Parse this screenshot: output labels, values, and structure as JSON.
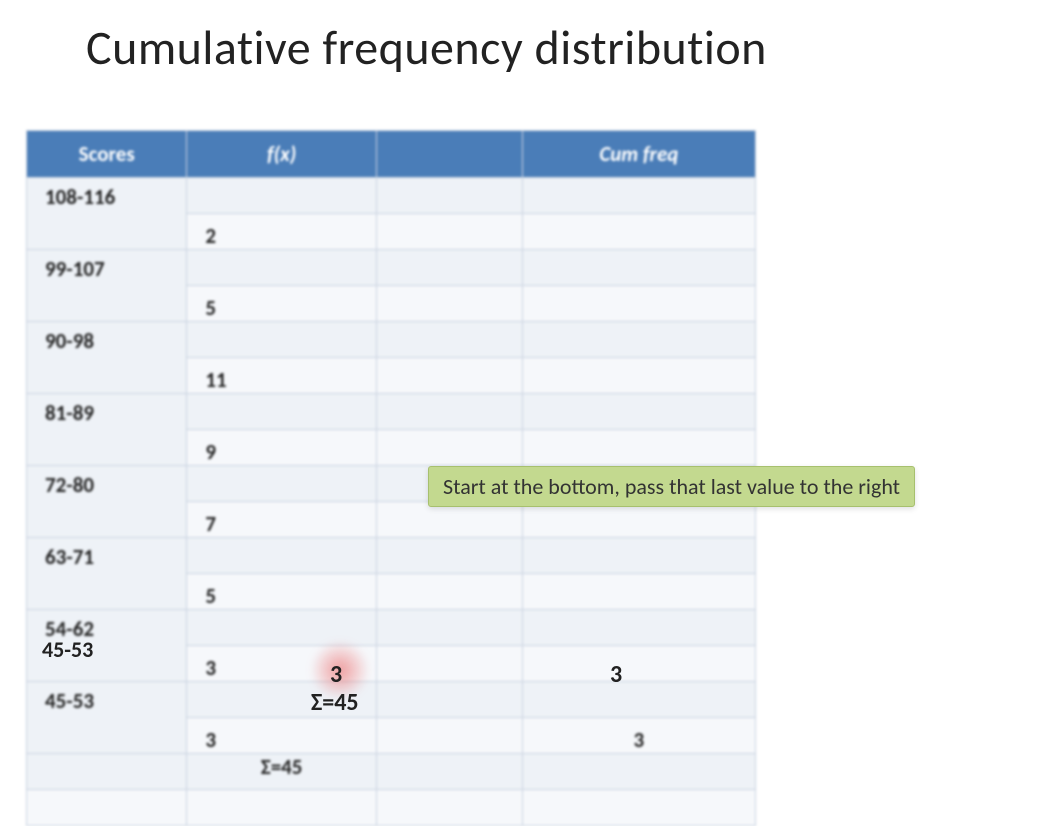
{
  "title": "Cumulative frequency distribution",
  "headers": {
    "scores": "Scores",
    "fx": "f(x)",
    "blank": "",
    "cum": "Cum freq"
  },
  "rows": [
    {
      "score": "108-116",
      "fx": "2",
      "cf": ""
    },
    {
      "score": "99-107",
      "fx": "5",
      "cf": ""
    },
    {
      "score": "90-98",
      "fx": "11",
      "cf": ""
    },
    {
      "score": "81-89",
      "fx": "9",
      "cf": ""
    },
    {
      "score": "72-80",
      "fx": "7",
      "cf": ""
    },
    {
      "score": "63-71",
      "fx": "5",
      "cf": ""
    },
    {
      "score": "54-62",
      "fx": "3",
      "cf": ""
    },
    {
      "score": "45-53",
      "fx": "3",
      "cf": "3"
    }
  ],
  "sum": "Σ=45",
  "callout": "Start at the bottom, pass that last value to the right",
  "chart_data": {
    "type": "table",
    "title": "Cumulative frequency distribution",
    "columns": [
      "Scores",
      "f(x)",
      "Cum freq"
    ],
    "data": [
      {
        "Scores": "108-116",
        "f(x)": 2,
        "Cum freq": null
      },
      {
        "Scores": "99-107",
        "f(x)": 5,
        "Cum freq": null
      },
      {
        "Scores": "90-98",
        "f(x)": 11,
        "Cum freq": null
      },
      {
        "Scores": "81-89",
        "f(x)": 9,
        "Cum freq": null
      },
      {
        "Scores": "72-80",
        "f(x)": 7,
        "Cum freq": null
      },
      {
        "Scores": "63-71",
        "f(x)": 5,
        "Cum freq": null
      },
      {
        "Scores": "54-62",
        "f(x)": 3,
        "Cum freq": null
      },
      {
        "Scores": "45-53",
        "f(x)": 3,
        "Cum freq": 3
      }
    ],
    "annotations": [
      "Σ=45",
      "Start at the bottom, pass that last value to the right"
    ]
  }
}
